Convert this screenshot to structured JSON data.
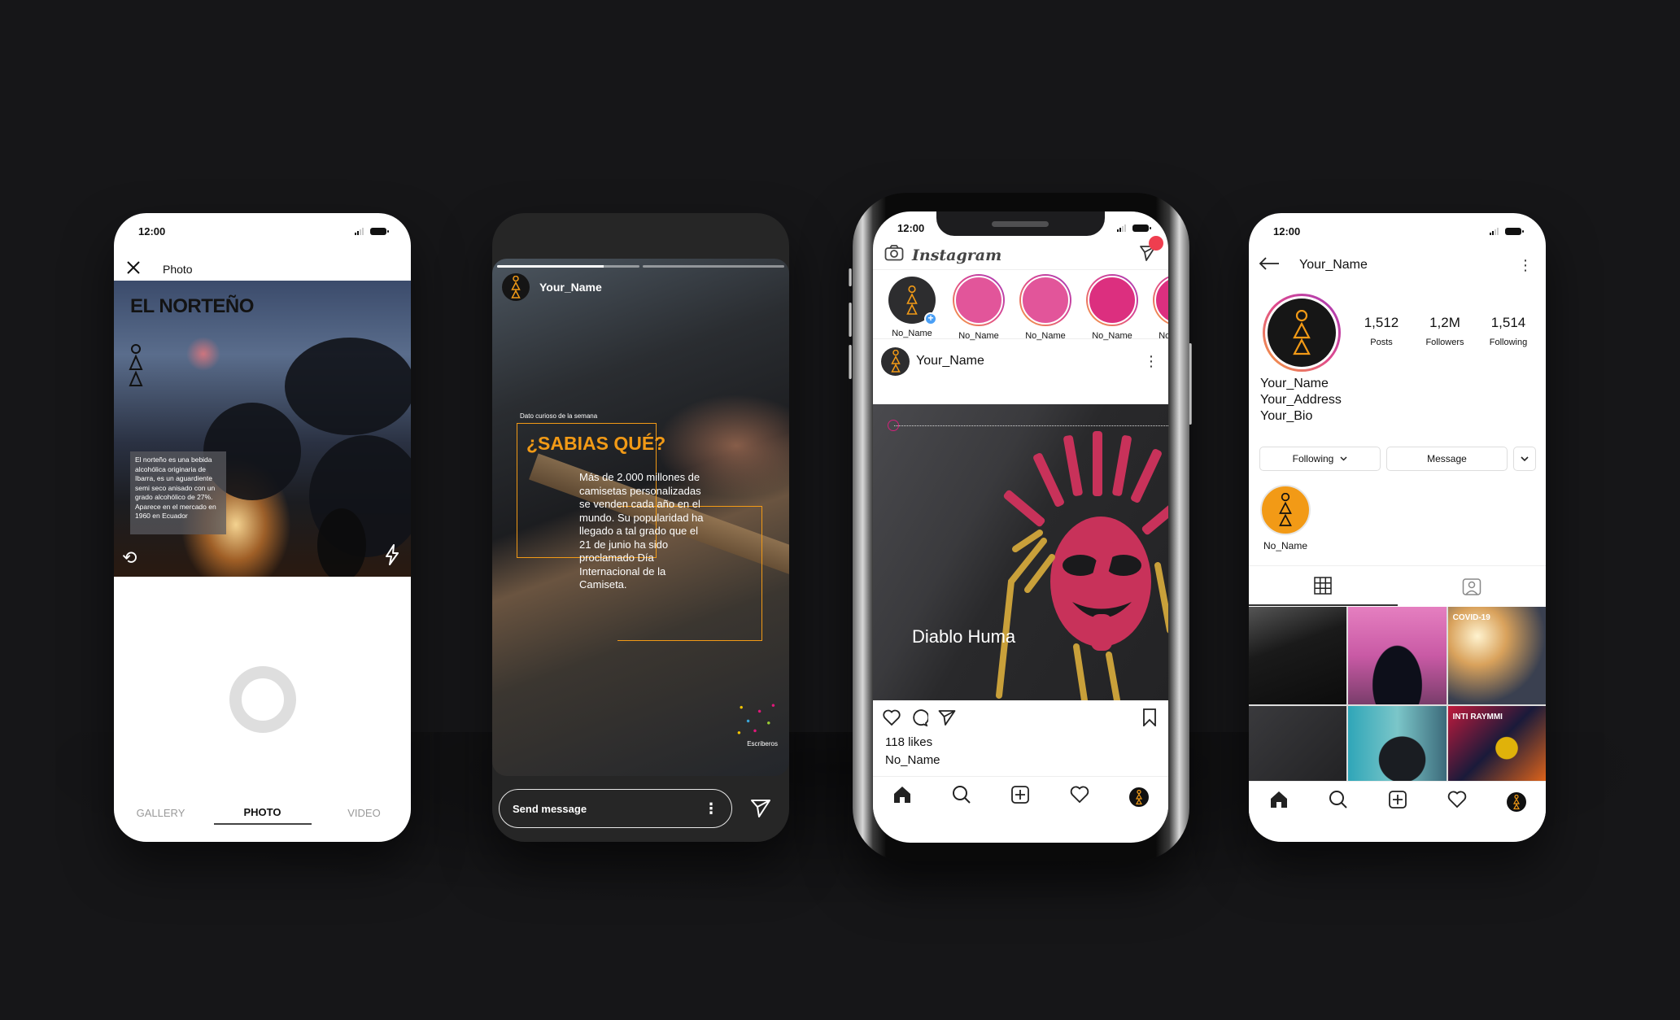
{
  "status_bar": {
    "time": "12:00"
  },
  "phone_camera": {
    "header_title": "Photo",
    "image": {
      "title": "EL NORTEÑO",
      "caption": "El norteño es una bebida alcohólica originaria de Ibarra, es un aguardiente semi seco anisado con un grado alcohólico de 27%. Aparece en el mercado en 1960 en Ecuador"
    },
    "tabs": [
      {
        "label": "GALLERY",
        "active": false
      },
      {
        "label": "PHOTO",
        "active": true
      },
      {
        "label": "VIDEO",
        "active": false
      }
    ]
  },
  "phone_story": {
    "username": "Your_Name",
    "progress": [
      0.75,
      0
    ],
    "kicker": "Dato curioso de la semana",
    "headline": "¿SABIAS QUÉ?",
    "body": "Más de 2.000 millones de camisetas personalizadas se venden cada año en el mundo. Su popularidad ha llegado a tal grado que el 21 de junio ha sido proclamado Día Internacional de la Camiseta.",
    "brand": "Escriberos",
    "send_placeholder": "Send message"
  },
  "phone_feed": {
    "app_name": "Instagram",
    "stories": [
      {
        "label": "No_Name",
        "own": true,
        "color": "#2d2d2f"
      },
      {
        "label": "No_Name",
        "own": false,
        "color": "#e2559a"
      },
      {
        "label": "No_Name",
        "own": false,
        "color": "#e2559a"
      },
      {
        "label": "No_Name",
        "own": false,
        "color": "#dc2f7f"
      },
      {
        "label": "No_Name",
        "own": false,
        "color": "#dc2f7f"
      }
    ],
    "post": {
      "username": "Your_Name",
      "image_caption": "Diablo Huma",
      "likes": "118 likes",
      "caption_user": "No_Name"
    }
  },
  "phone_profile": {
    "username": "Your_Name",
    "stats": [
      {
        "value": "1,512",
        "label": "Posts"
      },
      {
        "value": "1,2M",
        "label": "Followers"
      },
      {
        "value": "1,514",
        "label": "Following"
      }
    ],
    "bio": {
      "name": "Your_Name",
      "address": "Your_Address",
      "bio": "Your_Bio"
    },
    "buttons": {
      "following": "Following",
      "message": "Message"
    },
    "highlight": {
      "label": "No_Name"
    },
    "grid": [
      {
        "title": "",
        "bg": "linear-gradient(160deg,#555 0%,#1a1a1a 40%,#0c0c0c 100%)"
      },
      {
        "title": "",
        "bg": "radial-gradient(ellipse at 50% 80%,#0d0f1a 35%,rgba(0,0,0,0) 36%),linear-gradient(180deg,#e57fc0,#c95aa5 50%,#7a3d6b)"
      },
      {
        "title": "COVID-19",
        "bg": "radial-gradient(ellipse at 30% 30%,#fff3cf,#d9a25c 30%,#3a4050 70%)"
      },
      {
        "title": "",
        "bg": "linear-gradient(135deg,#3a3a3d,#222224)"
      },
      {
        "title": "",
        "bg": "radial-gradient(ellipse at 55% 70%,#1a1d22 30%,rgba(0,0,0,0) 31%),linear-gradient(90deg,#2fa6b8,#7bc6c9 50%,#3c6a7a)"
      },
      {
        "title": "INTI RAYMMI",
        "bg": "radial-gradient(circle at 60% 55%,#e0b20a 15%,rgba(0,0,0,0) 16%),linear-gradient(135deg,#c01a3c,#1a1a3a 50%,#e0641a)"
      }
    ]
  },
  "colors": {
    "brand_orange": "#f29a16",
    "brand_pink": "#d2237b",
    "notification_red": "#ef3e4f",
    "story_add_blue": "#4a9ff5",
    "background": "#161618"
  }
}
